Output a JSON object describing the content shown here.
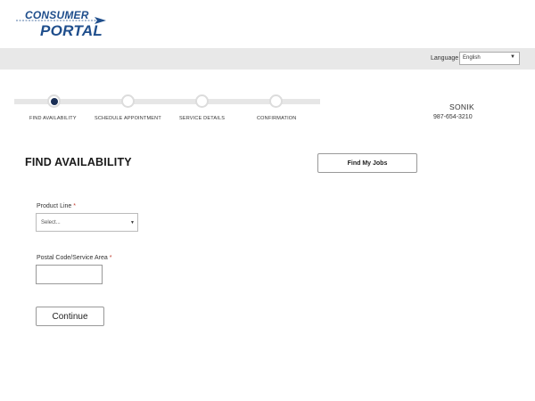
{
  "logo": {
    "line1": "CONSUMER",
    "line2": "PORTAL"
  },
  "language": {
    "label": "Language",
    "selected": "English"
  },
  "stepper": {
    "steps": [
      {
        "label": "FIND AVAILABILITY"
      },
      {
        "label": "SCHEDULE APPOINTMENT"
      },
      {
        "label": "SERVICE DETAILS"
      },
      {
        "label": "CONFIRMATION"
      }
    ],
    "active_step": 1
  },
  "user": {
    "name": "SONIK",
    "phone": "987-654-3210"
  },
  "main": {
    "title": "FIND AVAILABILITY",
    "find_jobs_label": "Find My Jobs",
    "product_line": {
      "label": "Product Line",
      "required_mark": "*",
      "selected": "Select..."
    },
    "postal_code": {
      "label": "Postal Code/Service Area",
      "required_mark": "*",
      "value": ""
    },
    "continue_label": "Continue"
  },
  "colors": {
    "brand": "#1f4e8c",
    "active_step": "#1a2f55",
    "required": "#c0392b",
    "language_bar": "#e8e8e8"
  }
}
